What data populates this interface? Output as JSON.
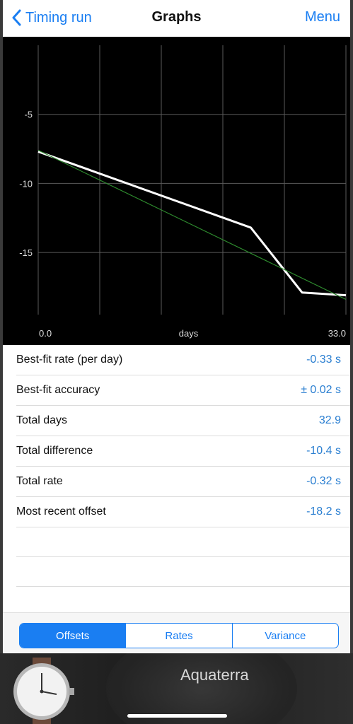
{
  "nav": {
    "back_label": "Timing run",
    "title": "Graphs",
    "menu_label": "Menu"
  },
  "chart_data": {
    "type": "line",
    "xlim": [
      0.0,
      33.0
    ],
    "ylim": [
      -19.5,
      0
    ],
    "x_tick_labels": [
      "0.0",
      "days",
      "33.0"
    ],
    "y_ticks": [
      -5,
      -10,
      -15
    ],
    "grid": true,
    "series": [
      {
        "color": "#ffffff",
        "points": [
          [
            0,
            -7.7
          ],
          [
            22.8,
            -13.2
          ],
          [
            28.3,
            -17.9
          ],
          [
            33.0,
            -18.1
          ]
        ]
      },
      {
        "color": "#2e8b2e",
        "points": [
          [
            0,
            -7.6
          ],
          [
            33.0,
            -18.4
          ]
        ]
      }
    ]
  },
  "stats": [
    {
      "label": "Best-fit rate (per day)",
      "value": "-0.33 s"
    },
    {
      "label": "Best-fit accuracy",
      "value": "± 0.02 s"
    },
    {
      "label": "Total days",
      "value": "32.9"
    },
    {
      "label": "Total difference",
      "value": "-10.4 s"
    },
    {
      "label": "Total rate",
      "value": "-0.32 s"
    },
    {
      "label": "Most recent offset",
      "value": "-18.2 s"
    }
  ],
  "segments": [
    {
      "label": "Offsets",
      "selected": true
    },
    {
      "label": "Rates",
      "selected": false
    },
    {
      "label": "Variance",
      "selected": false
    }
  ],
  "banner": {
    "text": "Aquaterra"
  },
  "colors": {
    "accent": "#1a7ef2",
    "value_text": "#2b7fd1",
    "fit_line": "#2e8b2e"
  }
}
